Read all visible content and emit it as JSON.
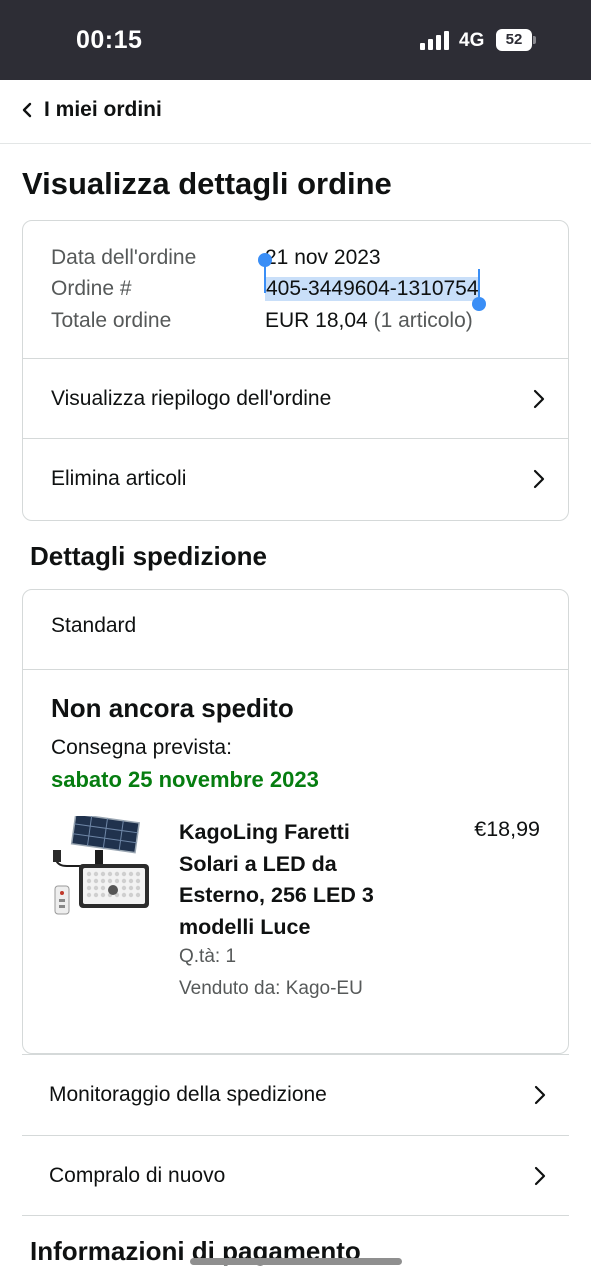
{
  "status_bar": {
    "time": "00:15",
    "network": "4G",
    "battery": "52"
  },
  "nav": {
    "back_label": "I miei ordini"
  },
  "page_title": "Visualizza dettagli ordine",
  "order_summary": {
    "date_label": "Data dell'ordine",
    "date_value": "21 nov 2023",
    "number_label": "Ordine #",
    "number_value": "405-3449604-1310754",
    "total_label": "Totale ordine",
    "total_value": "EUR 18,04",
    "total_items": "(1 articolo)"
  },
  "order_links": [
    {
      "label": "Visualizza riepilogo dell'ordine"
    },
    {
      "label": "Elimina articoli"
    }
  ],
  "shipping": {
    "section_title": "Dettagli spedizione",
    "method": "Standard",
    "status": "Non ancora spedito",
    "eta_label": "Consegna prevista:",
    "eta_date": "sabato 25 novembre 2023",
    "eta_color": "#067d10"
  },
  "product": {
    "name": "KagoLing Faretti Solari a LED da Esterno, 256 LED 3 modelli Luce",
    "price": "€18,99",
    "quantity": "Q.tà: 1",
    "seller": "Venduto da: Kago-EU"
  },
  "shipment_links": [
    {
      "label": "Monitoraggio della spedizione"
    },
    {
      "label": "Compralo di nuovo"
    }
  ],
  "payment_section_title": "Informazioni di pagamento"
}
